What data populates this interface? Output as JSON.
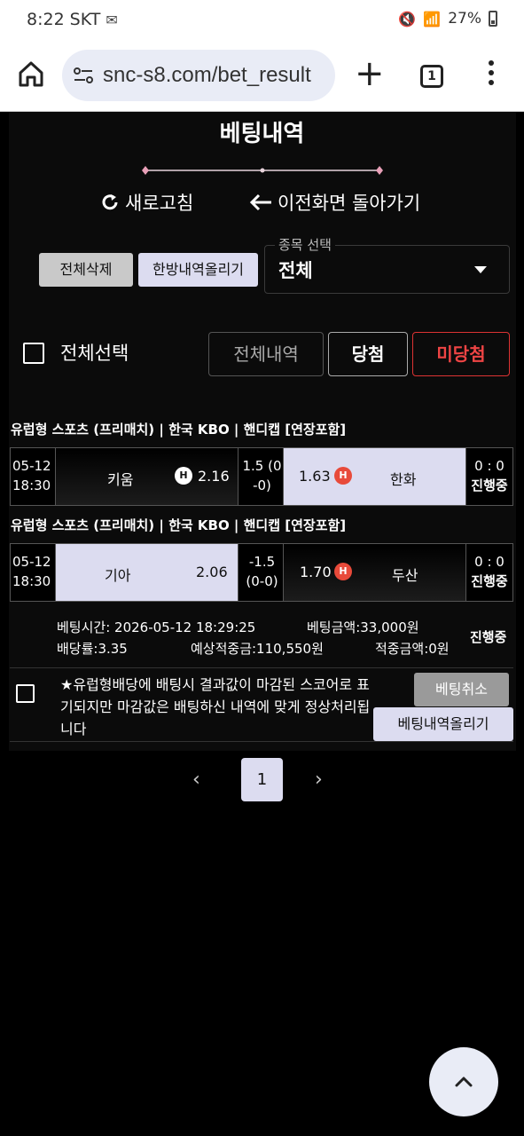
{
  "status_bar": {
    "time": "8:22",
    "carrier": "SKT",
    "battery": "27%"
  },
  "browser": {
    "url": "snc-s8.com/bet_result",
    "tab_count": "1"
  },
  "page": {
    "title": "베팅내역",
    "refresh_label": "새로고침",
    "back_label": "이전화면 돌아가기",
    "delete_all_label": "전체삭제",
    "upload_all_label": "한방내역올리기",
    "sport_select": {
      "label": "종목 선택",
      "value": "전체"
    },
    "select_all_label": "전체선택",
    "tabs": {
      "all": "전체내역",
      "win": "당첨",
      "lose": "미당첨"
    }
  },
  "bet": {
    "matches": [
      {
        "header": "유럽형 스포츠 (프리매치) | 한국 KBO  | 핸디캡 [연장포함]",
        "date": "05-12",
        "time": "18:30",
        "home_team": "키움",
        "home_odds": "2.16",
        "handicap_line1": "1.5 (0",
        "handicap_line2": "-0)",
        "away_odds": "1.63",
        "away_team": "한화",
        "score": "0 : 0",
        "status": "진행중",
        "selected": "away"
      },
      {
        "header": "유럽형 스포츠 (프리매치) | 한국 KBO  | 핸디캡 [연장포함]",
        "date": "05-12",
        "time": "18:30",
        "home_team": "기아",
        "home_odds": "2.06",
        "handicap_line1": "-1.5",
        "handicap_line2": "(0-0)",
        "away_odds": "1.70",
        "away_team": "두산",
        "score": "0 : 0",
        "status": "진행중",
        "selected": "home"
      }
    ],
    "bet_time": "베팅시간: 2026-05-12 18:29:25",
    "bet_amount": "베팅금액:33,000원",
    "odds_rate": "배당률:3.35",
    "expected_win": "예상적중금:110,550원",
    "won_amount": "적중금액:0원",
    "status": "진행중",
    "notice": "★유럽형배당에 배팅시 결과값이 마감된 스코어로 표기되지만 마감값은 배팅하신 내역에 맞게 정상처리됩니다",
    "cancel_label": "베팅취소",
    "upload_label": "베팅내역올리기",
    "handicap_badge": "H"
  },
  "pagination": {
    "current": "1"
  },
  "colors": {
    "selected_bg": "#dcdcf0",
    "lose_red": "#e44444",
    "badge_red": "#e84a3a"
  }
}
